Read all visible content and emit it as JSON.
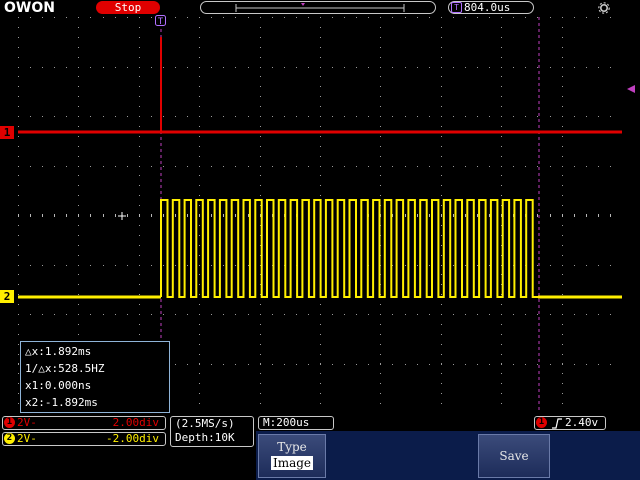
{
  "header": {
    "logo": "OWON",
    "status": "Stop",
    "trigger_marker_label": "T",
    "delay_label": "T",
    "delay_value": "804.0us"
  },
  "channels": [
    {
      "marker": "1",
      "color": "#e00000",
      "coupling": "1",
      "coupling_icon": "dc-coupling-icon",
      "scale": "2.00div"
    },
    {
      "marker": "2",
      "color": "#ffef00",
      "coupling": "2",
      "coupling_icon": "dc-coupling-icon",
      "scale": "-2.00div"
    }
  ],
  "ch1_info": {
    "badge": "1",
    "label": "2V-",
    "scale": "2.00div"
  },
  "ch2_info": {
    "badge": "2",
    "label": "2V-",
    "scale": "-2.00div"
  },
  "cursor": {
    "dx": "△x:1.892ms",
    "inv_dx": "1/△x:528.5HZ",
    "x1": "x1:0.000ns",
    "x2": "x2:-1.892ms"
  },
  "acquisition": {
    "sample_rate": "(2.5MS/s)",
    "depth": "Depth:10K",
    "timebase": "M:200us"
  },
  "trigger": {
    "source": "1",
    "edge_icon": "rising-edge-icon",
    "level": "2.40v"
  },
  "menu": {
    "type_label": "Type",
    "type_value": "Image",
    "save_label": "Save"
  },
  "colors": {
    "ch1": "#e00000",
    "ch2": "#ffef00",
    "cursor": "#c040c0",
    "accent": "#0b1c4a"
  }
}
